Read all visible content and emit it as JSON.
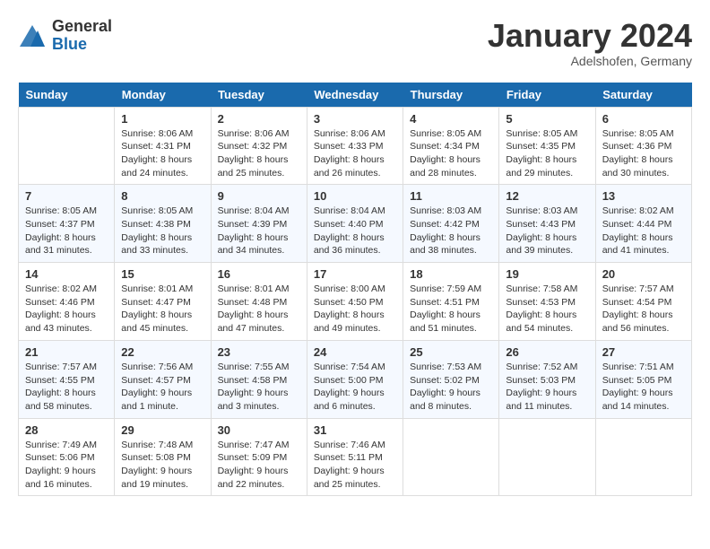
{
  "logo": {
    "general": "General",
    "blue": "Blue"
  },
  "title": "January 2024",
  "location": "Adelshofen, Germany",
  "days_header": [
    "Sunday",
    "Monday",
    "Tuesday",
    "Wednesday",
    "Thursday",
    "Friday",
    "Saturday"
  ],
  "weeks": [
    [
      {
        "day": "",
        "sunrise": "",
        "sunset": "",
        "daylight": ""
      },
      {
        "day": "1",
        "sunrise": "Sunrise: 8:06 AM",
        "sunset": "Sunset: 4:31 PM",
        "daylight": "Daylight: 8 hours and 24 minutes."
      },
      {
        "day": "2",
        "sunrise": "Sunrise: 8:06 AM",
        "sunset": "Sunset: 4:32 PM",
        "daylight": "Daylight: 8 hours and 25 minutes."
      },
      {
        "day": "3",
        "sunrise": "Sunrise: 8:06 AM",
        "sunset": "Sunset: 4:33 PM",
        "daylight": "Daylight: 8 hours and 26 minutes."
      },
      {
        "day": "4",
        "sunrise": "Sunrise: 8:05 AM",
        "sunset": "Sunset: 4:34 PM",
        "daylight": "Daylight: 8 hours and 28 minutes."
      },
      {
        "day": "5",
        "sunrise": "Sunrise: 8:05 AM",
        "sunset": "Sunset: 4:35 PM",
        "daylight": "Daylight: 8 hours and 29 minutes."
      },
      {
        "day": "6",
        "sunrise": "Sunrise: 8:05 AM",
        "sunset": "Sunset: 4:36 PM",
        "daylight": "Daylight: 8 hours and 30 minutes."
      }
    ],
    [
      {
        "day": "7",
        "sunrise": "Sunrise: 8:05 AM",
        "sunset": "Sunset: 4:37 PM",
        "daylight": "Daylight: 8 hours and 31 minutes."
      },
      {
        "day": "8",
        "sunrise": "Sunrise: 8:05 AM",
        "sunset": "Sunset: 4:38 PM",
        "daylight": "Daylight: 8 hours and 33 minutes."
      },
      {
        "day": "9",
        "sunrise": "Sunrise: 8:04 AM",
        "sunset": "Sunset: 4:39 PM",
        "daylight": "Daylight: 8 hours and 34 minutes."
      },
      {
        "day": "10",
        "sunrise": "Sunrise: 8:04 AM",
        "sunset": "Sunset: 4:40 PM",
        "daylight": "Daylight: 8 hours and 36 minutes."
      },
      {
        "day": "11",
        "sunrise": "Sunrise: 8:03 AM",
        "sunset": "Sunset: 4:42 PM",
        "daylight": "Daylight: 8 hours and 38 minutes."
      },
      {
        "day": "12",
        "sunrise": "Sunrise: 8:03 AM",
        "sunset": "Sunset: 4:43 PM",
        "daylight": "Daylight: 8 hours and 39 minutes."
      },
      {
        "day": "13",
        "sunrise": "Sunrise: 8:02 AM",
        "sunset": "Sunset: 4:44 PM",
        "daylight": "Daylight: 8 hours and 41 minutes."
      }
    ],
    [
      {
        "day": "14",
        "sunrise": "Sunrise: 8:02 AM",
        "sunset": "Sunset: 4:46 PM",
        "daylight": "Daylight: 8 hours and 43 minutes."
      },
      {
        "day": "15",
        "sunrise": "Sunrise: 8:01 AM",
        "sunset": "Sunset: 4:47 PM",
        "daylight": "Daylight: 8 hours and 45 minutes."
      },
      {
        "day": "16",
        "sunrise": "Sunrise: 8:01 AM",
        "sunset": "Sunset: 4:48 PM",
        "daylight": "Daylight: 8 hours and 47 minutes."
      },
      {
        "day": "17",
        "sunrise": "Sunrise: 8:00 AM",
        "sunset": "Sunset: 4:50 PM",
        "daylight": "Daylight: 8 hours and 49 minutes."
      },
      {
        "day": "18",
        "sunrise": "Sunrise: 7:59 AM",
        "sunset": "Sunset: 4:51 PM",
        "daylight": "Daylight: 8 hours and 51 minutes."
      },
      {
        "day": "19",
        "sunrise": "Sunrise: 7:58 AM",
        "sunset": "Sunset: 4:53 PM",
        "daylight": "Daylight: 8 hours and 54 minutes."
      },
      {
        "day": "20",
        "sunrise": "Sunrise: 7:57 AM",
        "sunset": "Sunset: 4:54 PM",
        "daylight": "Daylight: 8 hours and 56 minutes."
      }
    ],
    [
      {
        "day": "21",
        "sunrise": "Sunrise: 7:57 AM",
        "sunset": "Sunset: 4:55 PM",
        "daylight": "Daylight: 8 hours and 58 minutes."
      },
      {
        "day": "22",
        "sunrise": "Sunrise: 7:56 AM",
        "sunset": "Sunset: 4:57 PM",
        "daylight": "Daylight: 9 hours and 1 minute."
      },
      {
        "day": "23",
        "sunrise": "Sunrise: 7:55 AM",
        "sunset": "Sunset: 4:58 PM",
        "daylight": "Daylight: 9 hours and 3 minutes."
      },
      {
        "day": "24",
        "sunrise": "Sunrise: 7:54 AM",
        "sunset": "Sunset: 5:00 PM",
        "daylight": "Daylight: 9 hours and 6 minutes."
      },
      {
        "day": "25",
        "sunrise": "Sunrise: 7:53 AM",
        "sunset": "Sunset: 5:02 PM",
        "daylight": "Daylight: 9 hours and 8 minutes."
      },
      {
        "day": "26",
        "sunrise": "Sunrise: 7:52 AM",
        "sunset": "Sunset: 5:03 PM",
        "daylight": "Daylight: 9 hours and 11 minutes."
      },
      {
        "day": "27",
        "sunrise": "Sunrise: 7:51 AM",
        "sunset": "Sunset: 5:05 PM",
        "daylight": "Daylight: 9 hours and 14 minutes."
      }
    ],
    [
      {
        "day": "28",
        "sunrise": "Sunrise: 7:49 AM",
        "sunset": "Sunset: 5:06 PM",
        "daylight": "Daylight: 9 hours and 16 minutes."
      },
      {
        "day": "29",
        "sunrise": "Sunrise: 7:48 AM",
        "sunset": "Sunset: 5:08 PM",
        "daylight": "Daylight: 9 hours and 19 minutes."
      },
      {
        "day": "30",
        "sunrise": "Sunrise: 7:47 AM",
        "sunset": "Sunset: 5:09 PM",
        "daylight": "Daylight: 9 hours and 22 minutes."
      },
      {
        "day": "31",
        "sunrise": "Sunrise: 7:46 AM",
        "sunset": "Sunset: 5:11 PM",
        "daylight": "Daylight: 9 hours and 25 minutes."
      },
      {
        "day": "",
        "sunrise": "",
        "sunset": "",
        "daylight": ""
      },
      {
        "day": "",
        "sunrise": "",
        "sunset": "",
        "daylight": ""
      },
      {
        "day": "",
        "sunrise": "",
        "sunset": "",
        "daylight": ""
      }
    ]
  ]
}
